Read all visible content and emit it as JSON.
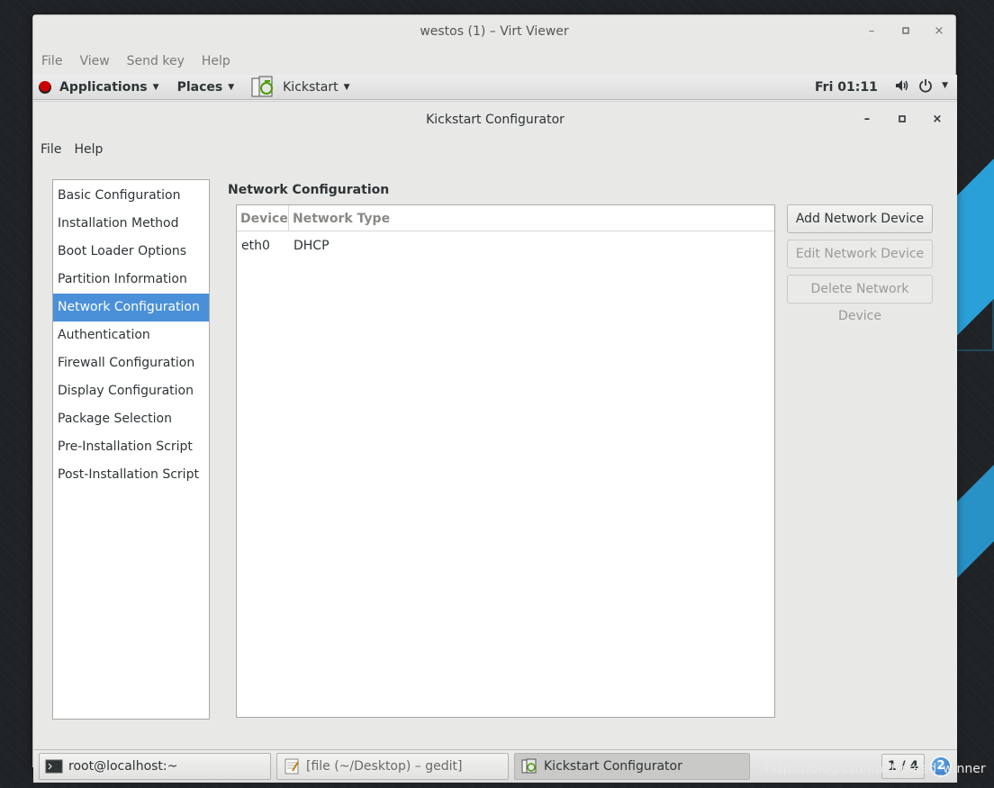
{
  "viewer": {
    "title": "westos (1) – Virt Viewer",
    "menu": [
      "File",
      "View",
      "Send key",
      "Help"
    ],
    "controls": {
      "minimize": "–",
      "maximize": "▫",
      "close": "×"
    }
  },
  "panel": {
    "applications": "Applications",
    "places": "Places",
    "app_name": "Kickstart",
    "clock": "Fri 01:11"
  },
  "kickstart": {
    "title": "Kickstart Configurator",
    "menu": [
      "File",
      "Help"
    ],
    "nav": [
      "Basic Configuration",
      "Installation Method",
      "Boot Loader Options",
      "Partition Information",
      "Network Configuration",
      "Authentication",
      "Firewall Configuration",
      "Display Configuration",
      "Package Selection",
      "Pre-Installation Script",
      "Post-Installation Script"
    ],
    "active_nav_index": 4,
    "section_title": "Network Configuration",
    "table": {
      "headers": [
        "Device",
        "Network Type"
      ],
      "rows": [
        [
          "eth0",
          "DHCP"
        ]
      ]
    },
    "buttons": {
      "add": "Add Network Device",
      "edit": "Edit Network Device",
      "delete": "Delete Network Device"
    }
  },
  "taskbar": {
    "tasks": [
      "root@localhost:~",
      "[file (~/Desktop) – gedit]",
      "Kickstart Configurator"
    ],
    "pager": "1 / 4",
    "badge": "2"
  },
  "watermark": "https://blog.csdn.net/bread_winner",
  "colors": {
    "selection": "#4a90d9",
    "desktop_accent": "#2aa0d8"
  }
}
